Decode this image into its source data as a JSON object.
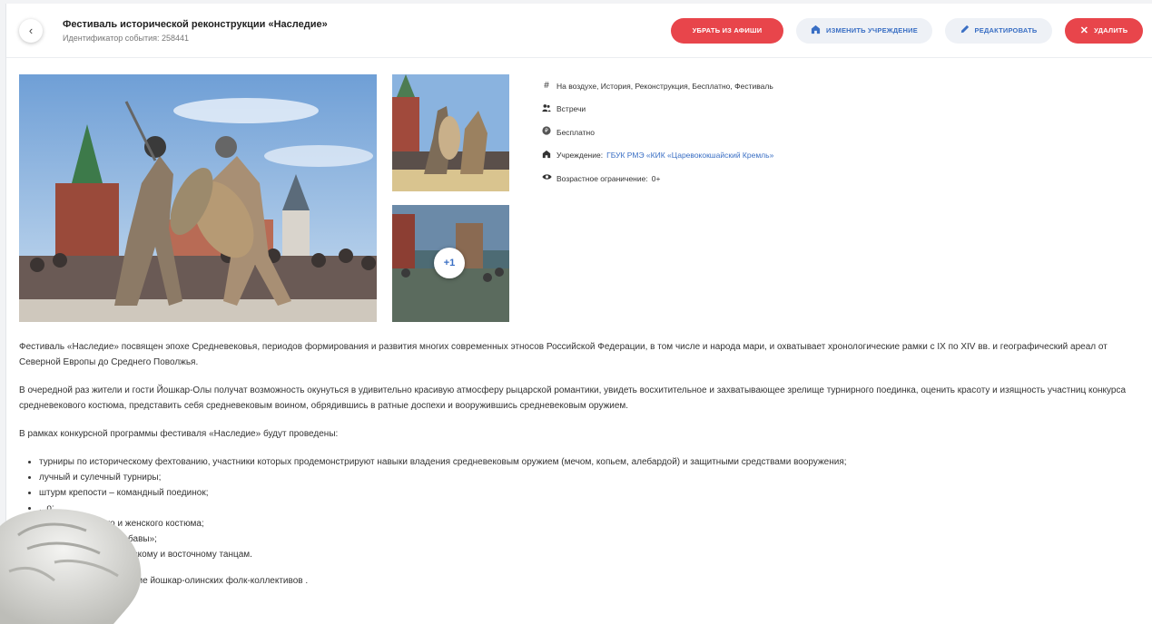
{
  "header": {
    "back_icon": "chevron-left-icon",
    "title": "Фестиваль исторической реконструкции «Наследие»",
    "event_id": "Идентификатор события: 258441",
    "buttons": {
      "remove_label": "УБРАТЬ ИЗ АФИШИ",
      "change_label": "ИЗМЕНИТЬ УЧРЕЖДЕНИЕ",
      "edit_label": "РЕДАКТИРОВАТЬ",
      "delete_label": "УДАЛИТЬ"
    },
    "colors": {
      "danger": "#e8454b",
      "link": "#3a6fc4"
    }
  },
  "gallery": {
    "more_count": "+1"
  },
  "meta": {
    "tags": "На воздухе, История, Реконструкция, Бесплатно, Фестиваль",
    "category": "Встречи",
    "price": "Бесплатно",
    "institution_label": "Учреждение:",
    "institution_value": "ГБУК РМЭ «КИК «Царевококшайский Кремль»",
    "age_label": "Возрастное ограничение:",
    "age_value": "0+"
  },
  "description": {
    "p1": "Фестиваль «Наследие» посвящен эпохе Средневековья, периодов формирования и развития многих современных этносов Российской Федерации, в том числе и народа мари, и охватывает хронологические рамки с IX по XIV вв. и географический ареал от Северной Европы до Среднего Поволжья.",
    "p2": "В очередной раз жители и гости Йошкар-Олы получат возможность окунуться в удивительно красивую атмосферу рыцарской романтики, увидеть восхитительное и захватывающее зрелище турнирного поединка, оценить красоту и изящность участниц конкурса средневекового костюма, представить себя средневековым воином, обрядившись в ратные доспехи и вооружившись средневековым оружием.",
    "p3": "В рамках конкурсной программы фестиваля «Наследие» будут проведены:",
    "items": [
      "турниры по историческому фехтованию, участники которых продемонстрируют навыки владения средневековым оружием (мечом, копьем, алебардой) и защитными средствами вооружения;",
      "лучный и сулечный турниры;",
      "штурм крепости – командный поединок;",
      "...о;",
      "...кового мужского и женского костюма;",
      "...ту «Богатырские забавы»;",
      "...торическому ирландскому и восточному танцам."
    ],
    "p4": "...ммы состоится выступление йошкар-олинских фолк-коллективов ."
  }
}
